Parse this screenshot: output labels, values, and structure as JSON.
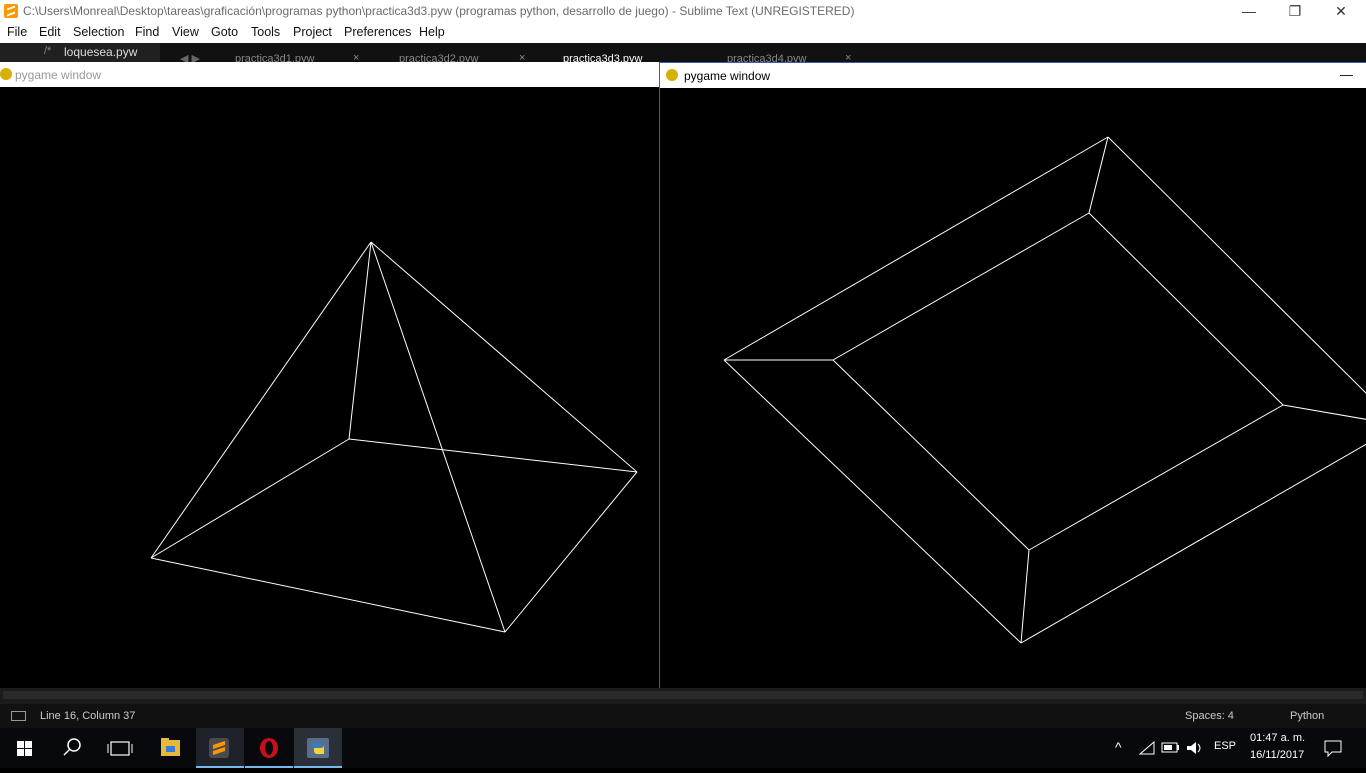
{
  "window": {
    "title": "C:\\Users\\Monreal\\Desktop\\tareas\\graficación\\programas python\\practica3d3.pyw (programas python, desarrollo de juego) - Sublime Text (UNREGISTERED)",
    "minimize": "—",
    "maximize": "❐",
    "close": "✕"
  },
  "menu": [
    "File",
    "Edit",
    "Selection",
    "Find",
    "View",
    "Goto",
    "Tools",
    "Project",
    "Preferences",
    "Help"
  ],
  "sidebar": {
    "file": "loquesea.pyw",
    "comment_glyph": "/*"
  },
  "tabs": [
    {
      "label": "practica3d1.pyw"
    },
    {
      "label": "practica3d2.pyw"
    },
    {
      "label": "practica3d3.pyw"
    },
    {
      "label": "practica3d4.pyw"
    }
  ],
  "tab_close": "×",
  "tab_nav": "◀ ▶",
  "pygame_left": {
    "title": "pygame window"
  },
  "pygame_right": {
    "title": "pygame window",
    "minimize": "—"
  },
  "status": {
    "position": "Line 16, Column 37",
    "spaces": "Spaces: 4",
    "syntax": "Python"
  },
  "taskbar": {
    "language": "ESP",
    "time": "01:47 a. m.",
    "date": "16/11/2017",
    "apps": [
      "windows-start",
      "search",
      "task-view",
      "file-explorer",
      "sublime-text",
      "opera",
      "python-idle"
    ]
  },
  "colors": {
    "accent": "#76b9ed",
    "sublime": "#ff9800",
    "opera": "#cc0f16",
    "wireframe": "#ffffff"
  }
}
